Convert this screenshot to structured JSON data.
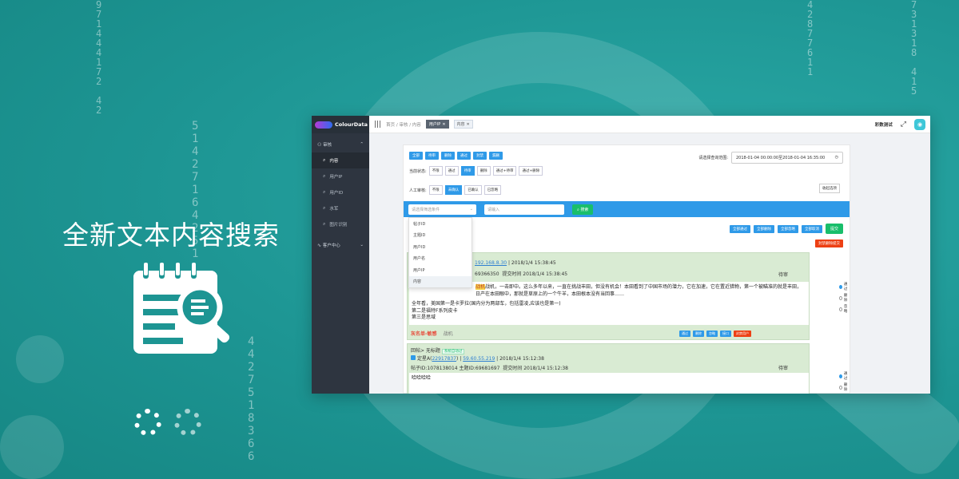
{
  "hero": {
    "title": "全新文本内容搜索"
  },
  "app": {
    "brand": "ColourData",
    "sidebar": {
      "group_label": "审核",
      "items": [
        {
          "label": "内容"
        },
        {
          "label": "用户IP"
        },
        {
          "label": "用户ID"
        },
        {
          "label": "水军"
        },
        {
          "label": "图片识别"
        }
      ],
      "group2_label": "客户中心"
    },
    "topbar": {
      "crumbs": "首页 / 审核 / 内容",
      "tabs": [
        {
          "label": "用户IP"
        },
        {
          "label": "内容"
        }
      ],
      "user": "彩数测试"
    },
    "filters": {
      "quick_buttons": [
        "全部",
        "待审",
        "删除",
        "通过",
        "封禁",
        "漏删"
      ],
      "date_label": "请选择查询范围:",
      "date_value": "2018-01-04 00:00:00至2018-01-04 16:35:00",
      "status_label": "当前状态:",
      "status_options": [
        "不限",
        "通过",
        "待审",
        "删除",
        "通过+待审",
        "通过+删除"
      ],
      "manual_label": "人工审核:",
      "manual_options": [
        "不限",
        "未确认",
        "已确认",
        "已忽略"
      ],
      "collapse_label": "收起选项"
    },
    "search": {
      "select_placeholder": "请选择筛选条件",
      "keyword_placeholder": "请输入",
      "button": "搜索",
      "options": [
        "帖子ID",
        "主题ID",
        "用户ID",
        "用户名",
        "用户IP",
        "内容"
      ]
    },
    "bulk_actions": [
      "全部通过",
      "全部删除",
      "全部忽略",
      "全部取消"
    ],
    "submit_label": "提交",
    "red_action": "封禁删除提交",
    "cards": [
      {
        "ip_part": "192.168.8.30",
        "time": "2018/1/4 15:38:45",
        "ids": "69366350",
        "submit_time": "提交时间 2018/1/4 15:38:45",
        "status": "待审",
        "text1": "战机，一击即中。这么多年以来，一直在挑战丰田，但没有机会！本田看到了中国市场的潜力，它在加速，它在置近猎物，第一个被瞄准的就是丰田，日产在本田眼中，那就是草原上的一个牛羊，本田根本没有当回事……",
        "text2": "全年看，美国第一是卡罗拉(国内分为两部车，包括雷凌,应该也是第一)",
        "text3": "第二是福特F系列皮卡",
        "text4": "第三是思域",
        "black_label": "灰名单-敏感",
        "keyword": "战机",
        "radios": [
          "通过",
          "删除",
          "忽略"
        ],
        "buttons": [
          "通过",
          "删除",
          "忽略",
          "接口",
          "封禁用户"
        ]
      },
      {
        "title": "回帖> 无标题",
        "tag": "系统自动过",
        "user": "定星A(",
        "uid": "22917837",
        "ip": "59.60.55.219",
        "time": "2018/1/4 15:12:38",
        "ids": "帖子ID:1078138014  主题ID:69681697",
        "submit_time": "提交时间 2018/1/4 15:12:38",
        "status": "待审",
        "text1": "哈哈哈哈",
        "radios": [
          "通过",
          "删除",
          "忽略"
        ]
      }
    ]
  }
}
